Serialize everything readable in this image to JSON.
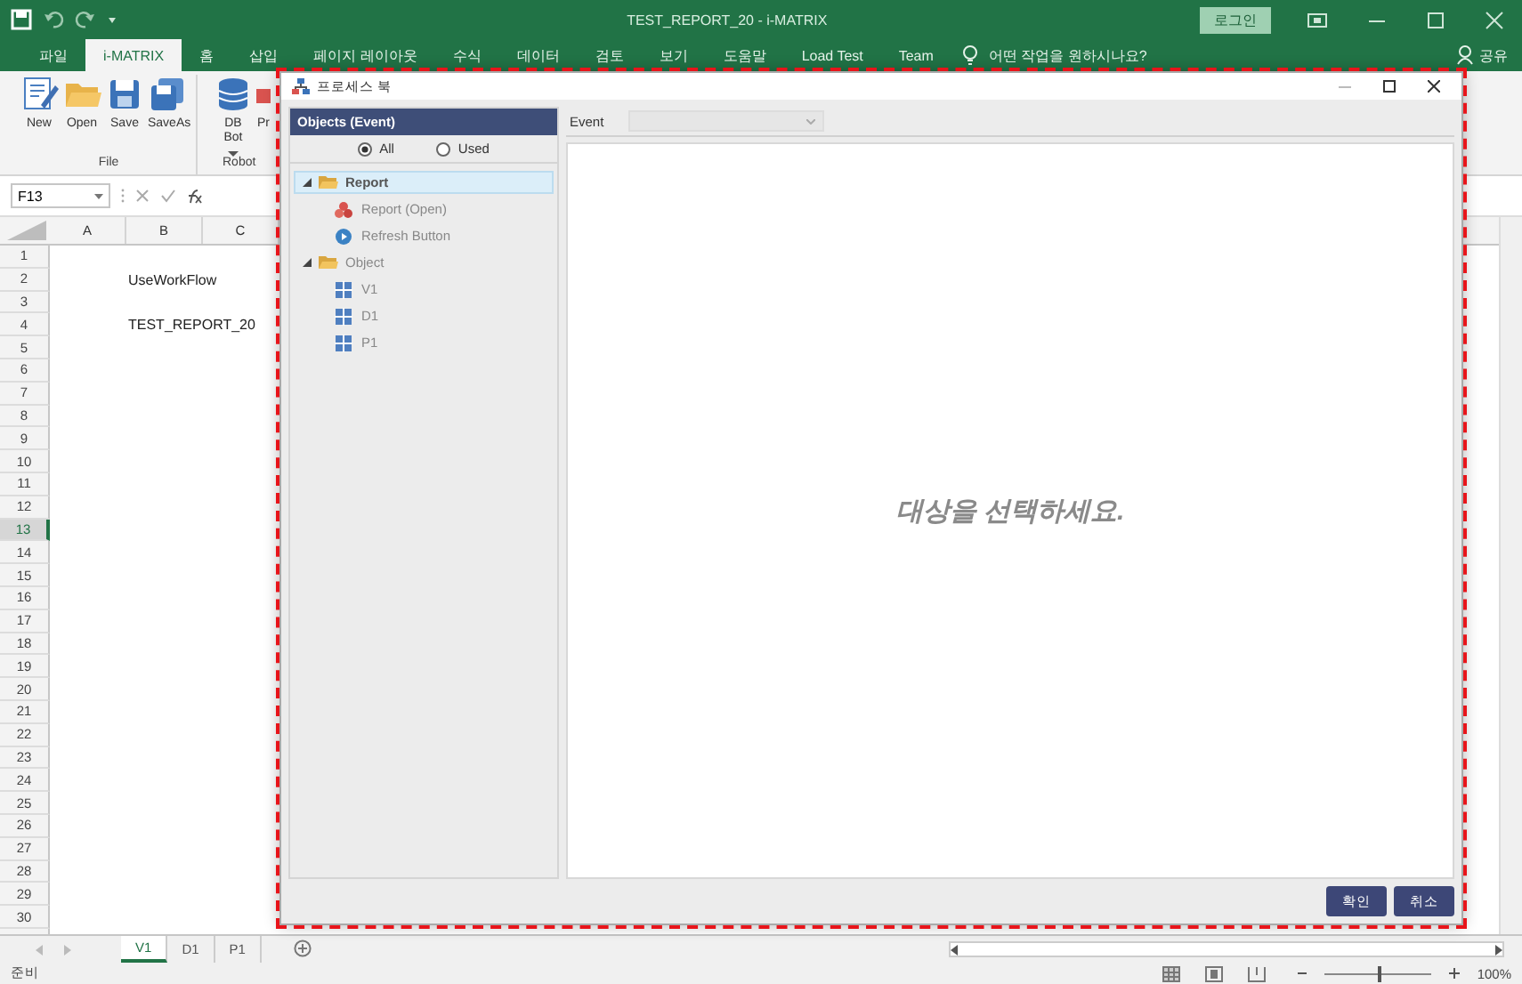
{
  "window": {
    "title": "TEST_REPORT_20  -  i-MATRIX",
    "login_button": "로그인"
  },
  "ribbon_tabs": [
    {
      "label": "파일",
      "selected": false
    },
    {
      "label": "i-MATRIX",
      "selected": true
    },
    {
      "label": "홈",
      "selected": false
    },
    {
      "label": "삽입",
      "selected": false
    },
    {
      "label": "페이지 레이아웃",
      "selected": false
    },
    {
      "label": "수식",
      "selected": false
    },
    {
      "label": "데이터",
      "selected": false
    },
    {
      "label": "검토",
      "selected": false
    },
    {
      "label": "보기",
      "selected": false
    },
    {
      "label": "도움말",
      "selected": false
    },
    {
      "label": "Load Test",
      "selected": false
    },
    {
      "label": "Team",
      "selected": false
    }
  ],
  "tell_me": {
    "placeholder": "어떤 작업을 원하시나요?"
  },
  "share": "공유",
  "ribbon_groups": [
    {
      "label": "File",
      "buttons": [
        {
          "label": "New",
          "kind": "new",
          "dropdown": false
        },
        {
          "label": "Open",
          "kind": "open",
          "dropdown": false
        },
        {
          "label": "Save",
          "kind": "save",
          "dropdown": false
        },
        {
          "label": "SaveAs",
          "kind": "saveas",
          "dropdown": false
        }
      ]
    },
    {
      "label": "Robot",
      "buttons": [
        {
          "label": "DB Bot",
          "kind": "database",
          "dropdown": true
        },
        {
          "label": "Pr",
          "kind": "process",
          "dropdown": false
        }
      ]
    }
  ],
  "formula_bar": {
    "name_box": "F13"
  },
  "sheet": {
    "columns": [
      "A",
      "B",
      "C"
    ],
    "rows": [
      {
        "number": "1",
        "selected": false
      },
      {
        "number": "2",
        "selected": false,
        "cell_b": "UseWorkFlow"
      },
      {
        "number": "3",
        "selected": false
      },
      {
        "number": "4",
        "selected": false,
        "cell_b": "TEST_REPORT_20"
      },
      {
        "number": "5",
        "selected": false
      },
      {
        "number": "6",
        "selected": false
      },
      {
        "number": "7",
        "selected": false
      },
      {
        "number": "8",
        "selected": false
      },
      {
        "number": "9",
        "selected": false
      },
      {
        "number": "10",
        "selected": false
      },
      {
        "number": "11",
        "selected": false
      },
      {
        "number": "12",
        "selected": false
      },
      {
        "number": "13",
        "selected": true
      },
      {
        "number": "14",
        "selected": false
      },
      {
        "number": "15",
        "selected": false
      },
      {
        "number": "16",
        "selected": false
      },
      {
        "number": "17",
        "selected": false
      },
      {
        "number": "18",
        "selected": false
      },
      {
        "number": "19",
        "selected": false
      },
      {
        "number": "20",
        "selected": false
      },
      {
        "number": "21",
        "selected": false
      },
      {
        "number": "22",
        "selected": false
      },
      {
        "number": "23",
        "selected": false
      },
      {
        "number": "24",
        "selected": false
      },
      {
        "number": "25",
        "selected": false
      },
      {
        "number": "26",
        "selected": false
      },
      {
        "number": "27",
        "selected": false
      },
      {
        "number": "28",
        "selected": false
      },
      {
        "number": "29",
        "selected": false
      },
      {
        "number": "30",
        "selected": false
      }
    ]
  },
  "sheet_tabs": [
    {
      "label": "V1",
      "selected": true
    },
    {
      "label": "D1",
      "selected": false
    },
    {
      "label": "P1",
      "selected": false
    }
  ],
  "status_bar": {
    "status": "준비",
    "zoom_slider": {
      "level": 0.5
    },
    "zoom": "100%"
  },
  "dialog": {
    "title": "프로세스 북",
    "objects_panel": {
      "header": "Objects (Event)",
      "filters": [
        {
          "label": "All",
          "selected": true
        },
        {
          "label": "Used",
          "selected": false
        }
      ],
      "tree": [
        {
          "label": "Report",
          "kind": "folder",
          "expanded": true,
          "selected": true,
          "children": [
            {
              "label": "Report (Open)",
              "kind": "report",
              "selected": false
            },
            {
              "label": "Refresh Button",
              "kind": "button",
              "selected": false
            }
          ]
        },
        {
          "label": "Object",
          "kind": "folder",
          "expanded": true,
          "selected": false,
          "children": [
            {
              "label": "V1",
              "kind": "grid",
              "selected": false
            },
            {
              "label": "D1",
              "kind": "grid",
              "selected": false
            },
            {
              "label": "P1",
              "kind": "grid",
              "selected": false
            }
          ]
        }
      ]
    },
    "event": {
      "label": "Event",
      "disabled": true
    },
    "message": "대상을 선택하세요.",
    "buttons": [
      "확인",
      "취소"
    ]
  }
}
